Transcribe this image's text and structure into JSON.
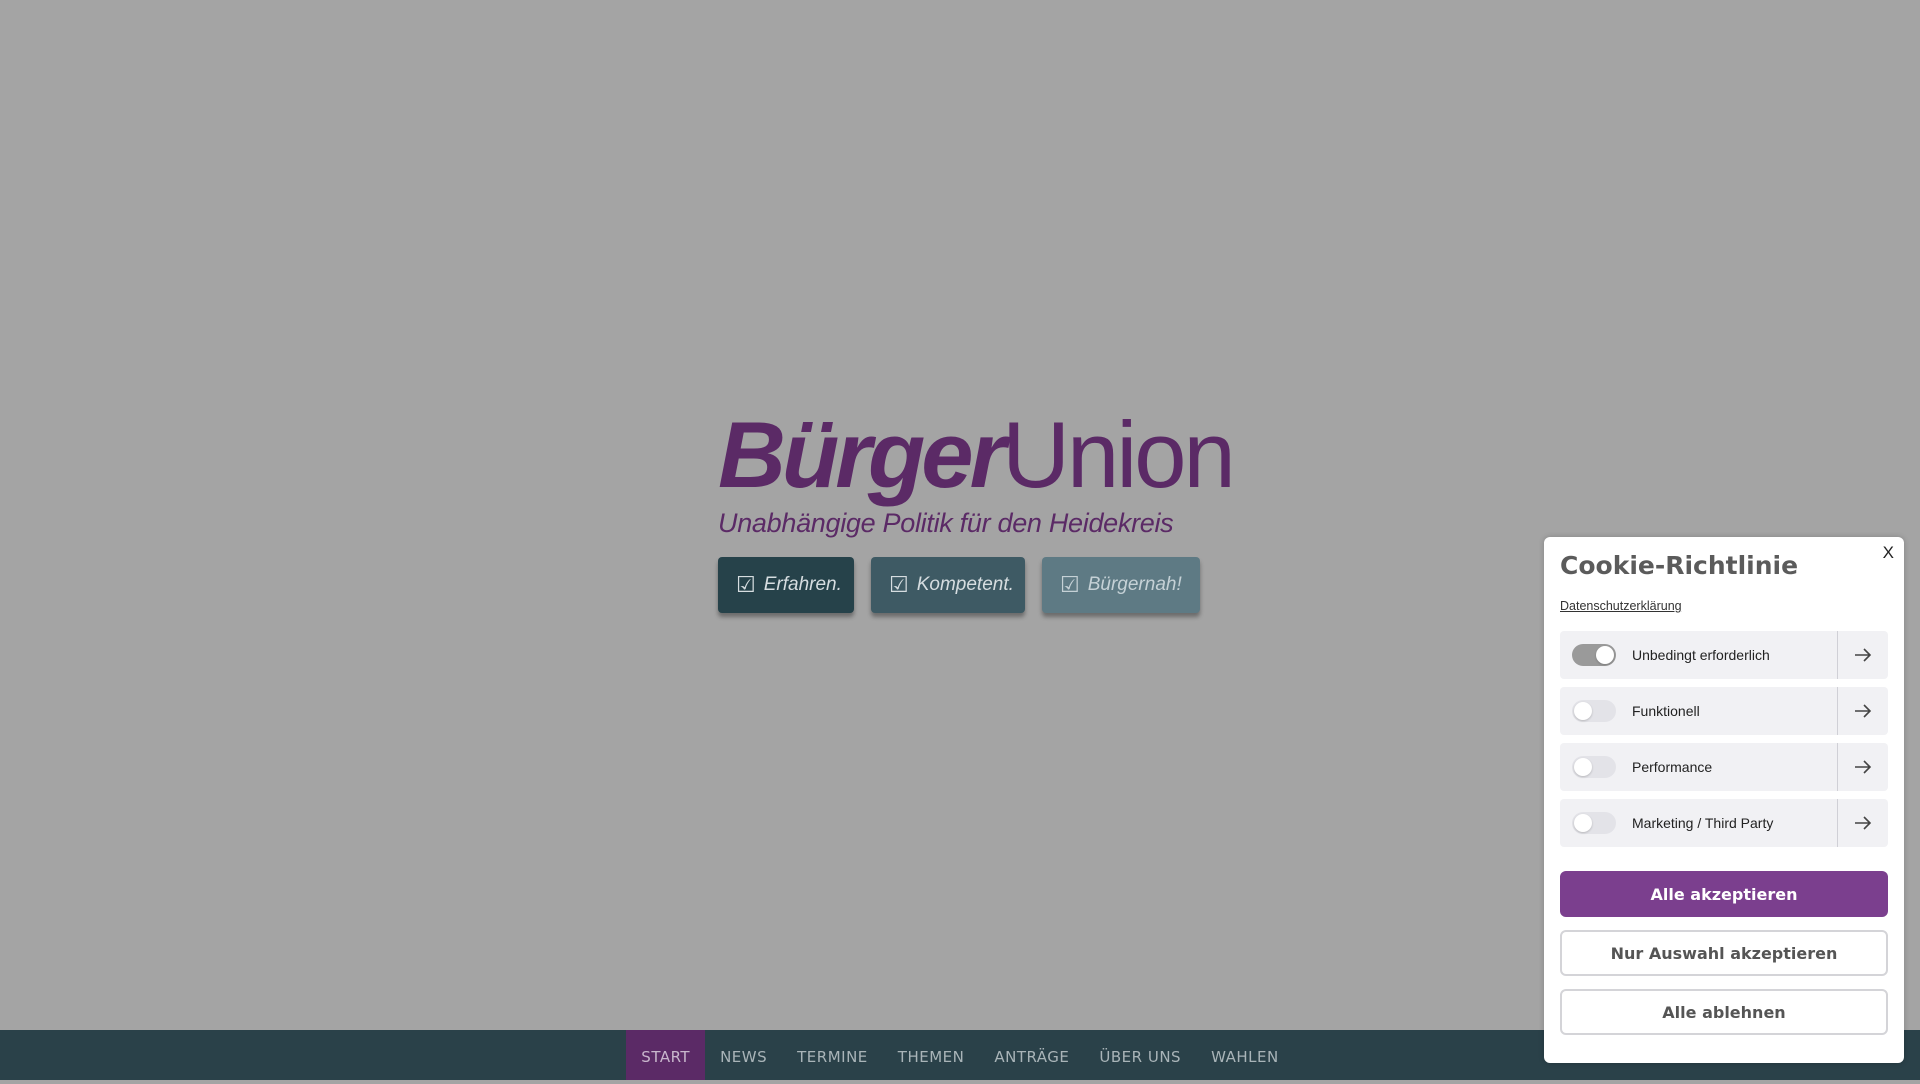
{
  "logo": {
    "word1": "Bürger",
    "word2": "Union",
    "tagline": "Unabhängige Politik für den Heidekreis"
  },
  "pills": [
    {
      "label": "Erfahren."
    },
    {
      "label": "Kompetent."
    },
    {
      "label": "Bürgernah!"
    }
  ],
  "nav": {
    "items": [
      "START",
      "NEWS",
      "TERMINE",
      "THEMEN",
      "ANTRÄGE",
      "ÜBER UNS",
      "WAHLEN"
    ],
    "active": "START"
  },
  "cookie": {
    "title": "Cookie-Richtlinie",
    "close_label": "X",
    "privacy_link": "Datenschutzerklärung",
    "categories": [
      {
        "label": "Unbedingt erforderlich",
        "enabled": true
      },
      {
        "label": "Funktionell",
        "enabled": false
      },
      {
        "label": "Performance",
        "enabled": false
      },
      {
        "label": "Marketing / Third Party",
        "enabled": false
      }
    ],
    "accept_all": "Alle akzeptieren",
    "accept_selection": "Nur Auswahl akzeptieren",
    "reject_all": "Alle ablehnen"
  },
  "colors": {
    "brand": "#5b2a66",
    "accent": "#7b3f8e",
    "nav_bg": "#2a4149",
    "overlay": "#a4a4a4"
  }
}
